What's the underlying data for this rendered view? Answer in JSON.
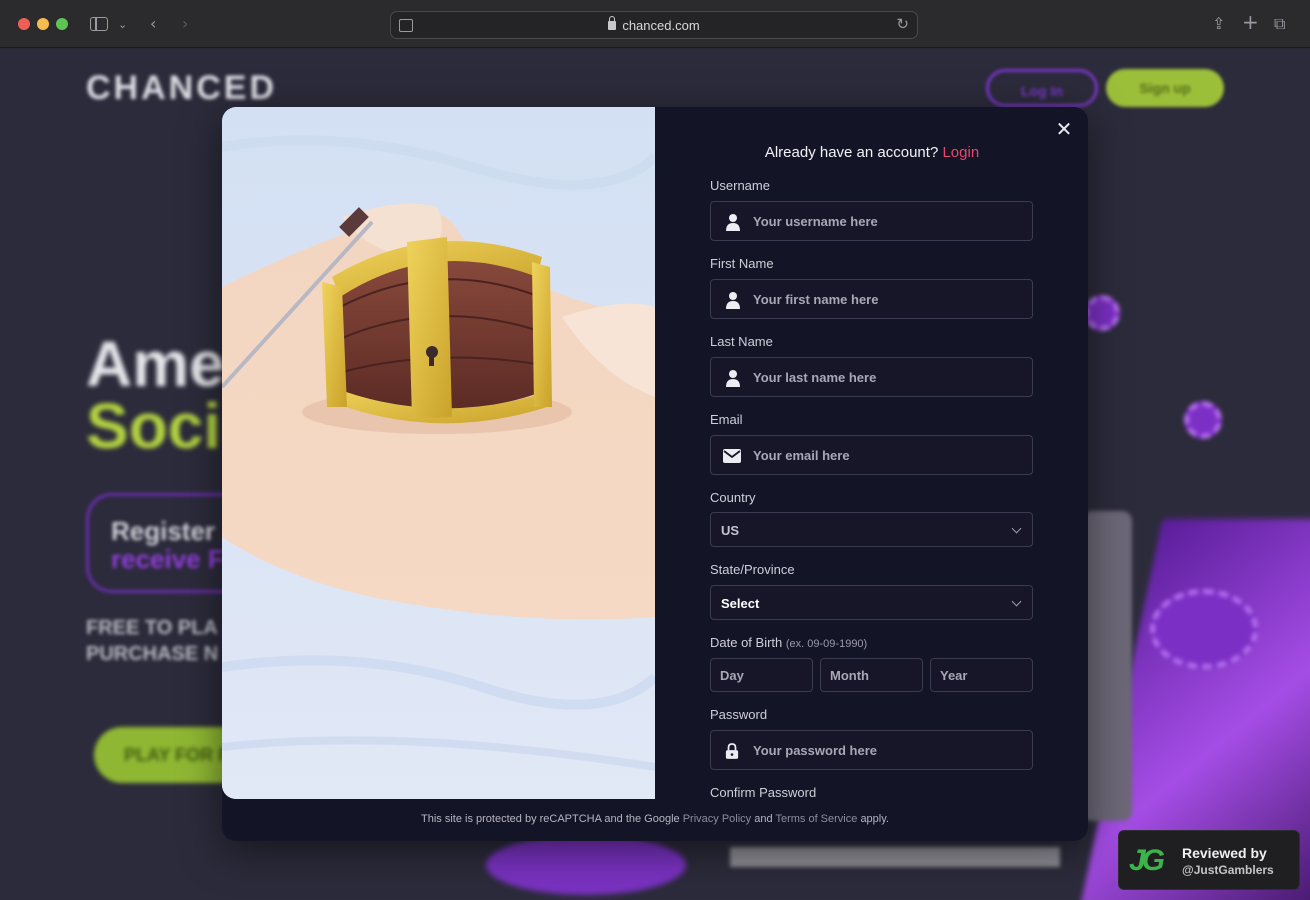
{
  "browser": {
    "url": "chanced.com"
  },
  "background": {
    "logo": "CHANCED",
    "login_label": "Log In",
    "signup_label": "Sign up",
    "hero_line1": "Ame",
    "hero_line2": "Soci",
    "register_line1": "Register",
    "register_line2": "receive F",
    "free_line1": "FREE TO PLA",
    "free_line2": "PURCHASE N",
    "play_label": "PLAY FOR F"
  },
  "modal": {
    "already_text": "Already have an account?",
    "login_link": "Login",
    "close_icon": "close-icon",
    "fields": {
      "username": {
        "label": "Username",
        "placeholder": "Your username here",
        "icon": "user-icon"
      },
      "first_name": {
        "label": "First Name",
        "placeholder": "Your first name here",
        "icon": "user-icon"
      },
      "last_name": {
        "label": "Last Name",
        "placeholder": "Your last name here",
        "icon": "user-icon"
      },
      "email": {
        "label": "Email",
        "placeholder": "Your email here",
        "icon": "mail-icon"
      },
      "country": {
        "label": "Country",
        "value": "US"
      },
      "state": {
        "label": "State/Province",
        "value": "Select"
      },
      "dob": {
        "label": "Date of Birth",
        "hint": "(ex. 09-09-1990)",
        "day": "Day",
        "month": "Month",
        "year": "Year"
      },
      "password": {
        "label": "Password",
        "placeholder": "Your password here",
        "icon": "lock-icon"
      },
      "confirm_password": {
        "label": "Confirm Password"
      }
    },
    "footer": {
      "prefix": "This site is protected by reCAPTCHA and the Google",
      "privacy": "Privacy Policy",
      "and": "and",
      "terms": "Terms of Service",
      "suffix": "apply."
    }
  },
  "review_badge": {
    "logo": "JG",
    "line1": "Reviewed by",
    "line2": "@JustGamblers"
  },
  "colors": {
    "accent_login": "#e9466b",
    "modal_bg": "#141427",
    "brand_green": "#3bb54a"
  }
}
